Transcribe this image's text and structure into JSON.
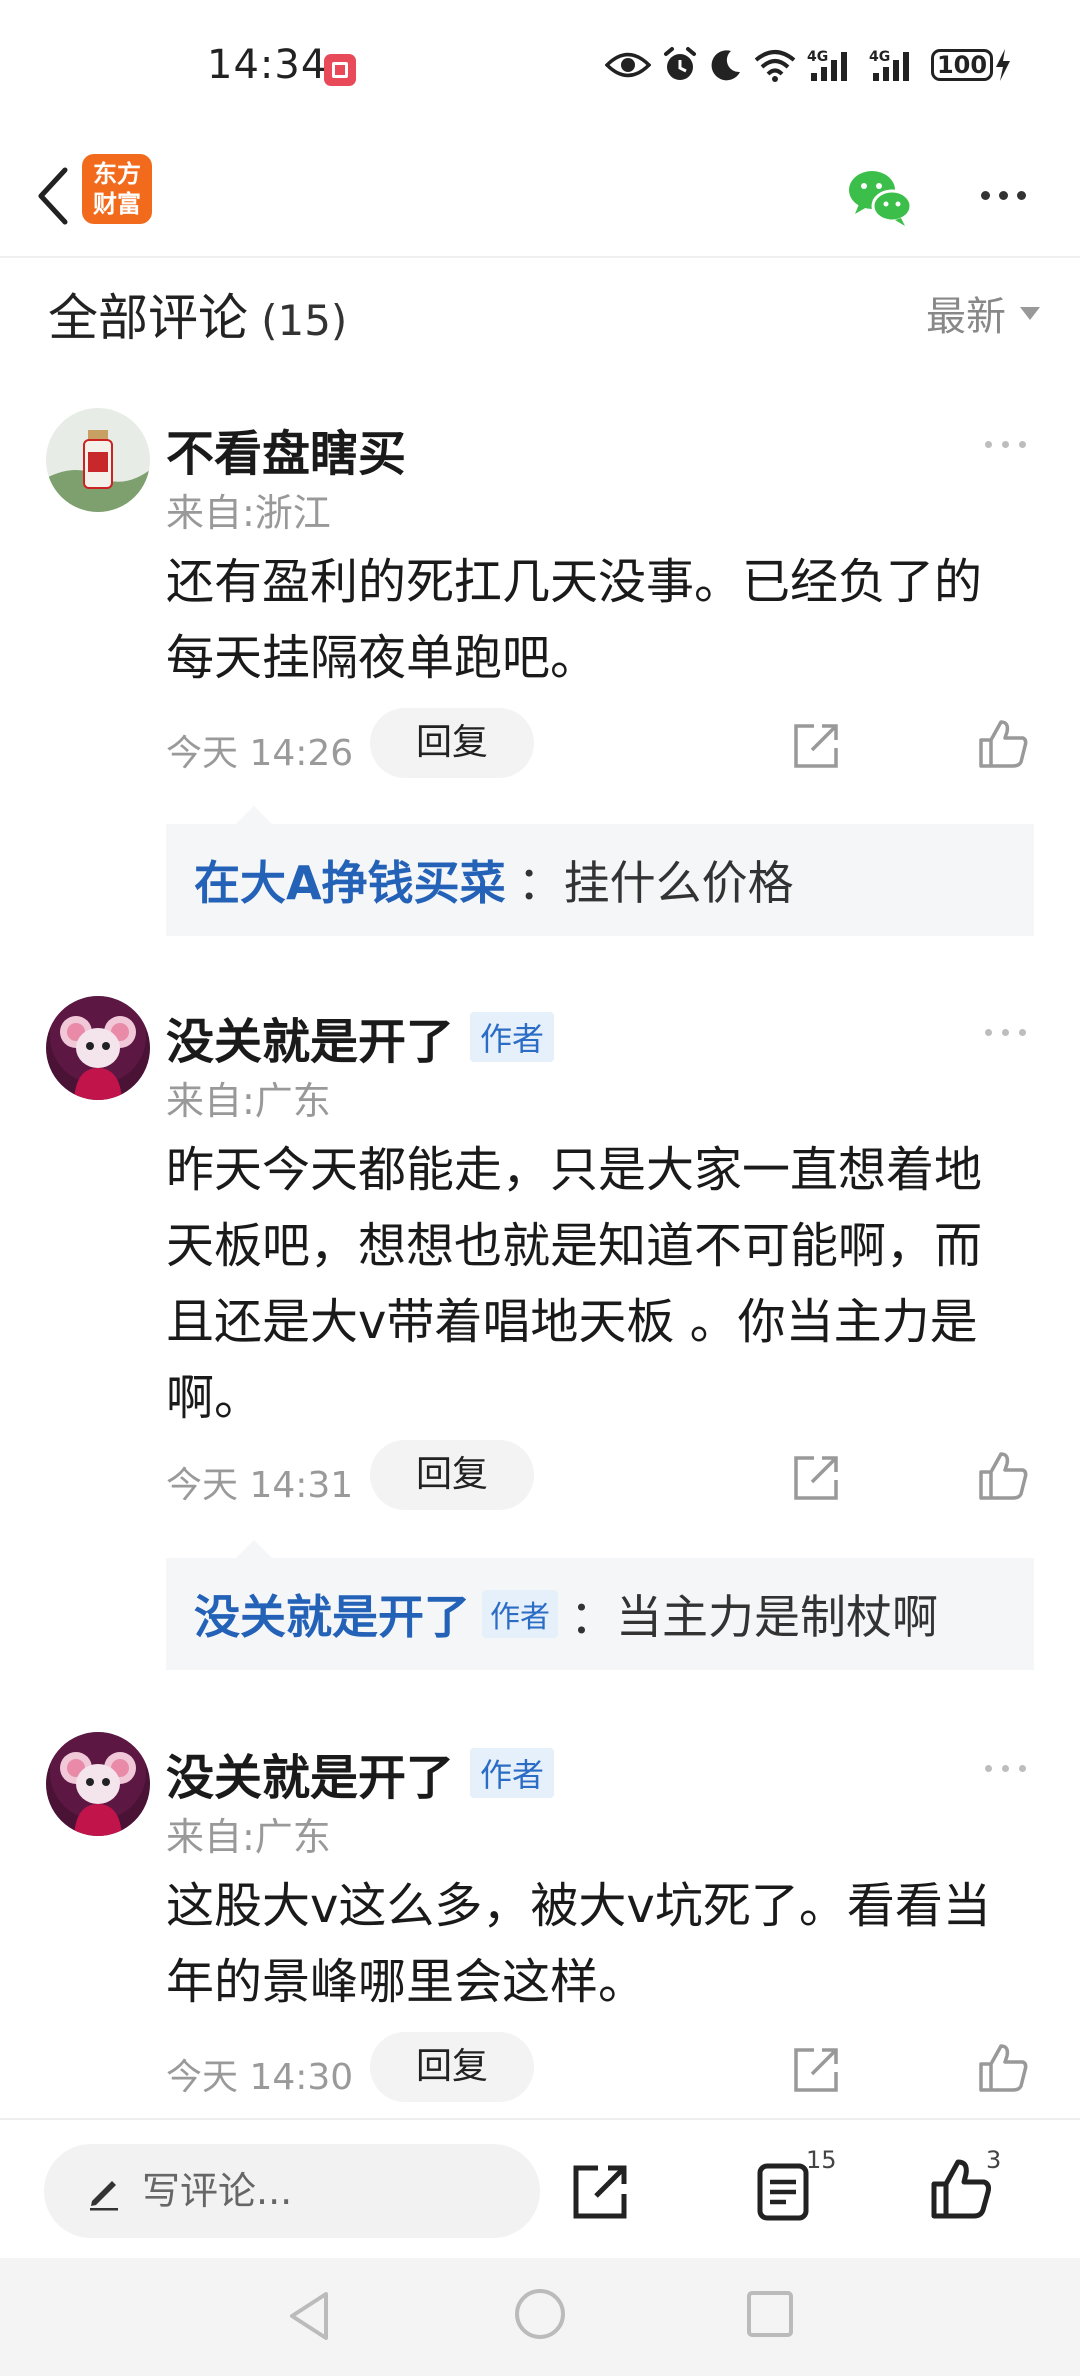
{
  "status_bar": {
    "time": "14:34",
    "network_1": "4G",
    "network_2": "4G",
    "battery": "100"
  },
  "app": {
    "logo_line1": "东方",
    "logo_line2": "财富"
  },
  "colors": {
    "accent_blue": "#2462b8",
    "logo_orange": "#f26b1d",
    "wechat_green": "#3cbf4a"
  },
  "header": {
    "title": "全部评论",
    "count": "(15)",
    "sort_label": "最新"
  },
  "comments": [
    {
      "user": "不看盘瞎买",
      "is_author": false,
      "location": "来自:浙江",
      "text_line1": "还有盈利的死扛几天没事。已经负了的",
      "text_line2": "每天挂隔夜单跑吧。",
      "time": "今天 14:26",
      "reply_label": "回复",
      "reply": {
        "user": "在大A挣钱买菜",
        "user_is_author": false,
        "text": "：挂什么价格"
      }
    },
    {
      "user": "没关就是开了",
      "is_author": true,
      "author_tag": "作者",
      "location": "来自:广东",
      "text_line1": "昨天今天都能走，只是大家一直想着地",
      "text_line2": "天板吧，想想也就是知道不可能啊，而",
      "text_line3": "且还是大v带着唱地天板 。你当主力是",
      "text_line4": "啊。",
      "time": "今天 14:31",
      "reply_label": "回复",
      "reply": {
        "user": "没关就是开了",
        "user_is_author": true,
        "author_tag": "作者",
        "text": "：当主力是制杖啊"
      }
    },
    {
      "user": "没关就是开了",
      "is_author": true,
      "author_tag": "作者",
      "location": "来自:广东",
      "text_line1": "这股大v这么多，被大v坑死了。看看当",
      "text_line2": "年的景峰哪里会这样。",
      "time": "今天 14:30",
      "reply_label": "回复"
    }
  ],
  "bottom_bar": {
    "input_placeholder": "写评论...",
    "comment_count": "15",
    "like_count": "3"
  }
}
